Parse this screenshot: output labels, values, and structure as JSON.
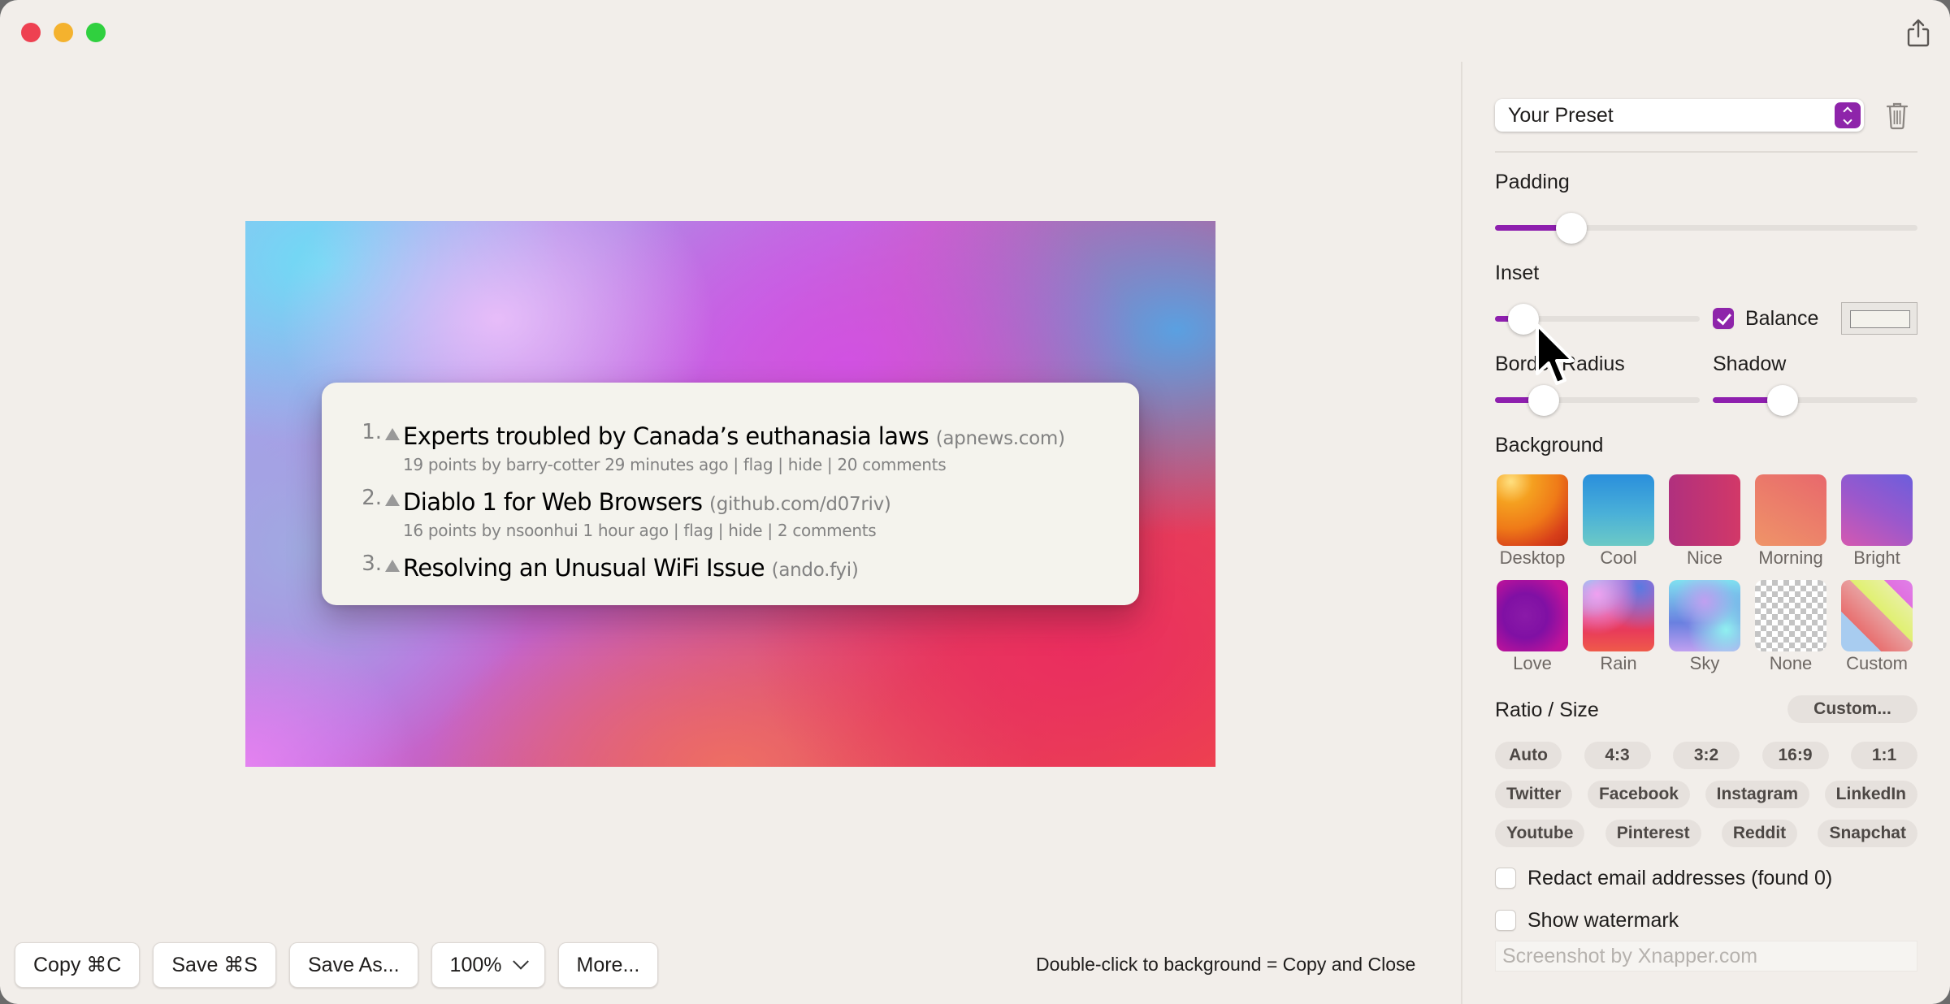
{
  "window": {
    "traffic_lights": [
      "close",
      "minimize",
      "zoom"
    ]
  },
  "canvas": {
    "background_preset": "Rain",
    "items": [
      {
        "rank": "1.",
        "title": "Experts troubled by Canada’s euthanasia laws",
        "site": "(apnews.com)",
        "subtext": "19 points by barry-cotter 29 minutes ago | flag | hide | 20 comments"
      },
      {
        "rank": "2.",
        "title": "Diablo 1 for Web Browsers",
        "site": "(github.com/d07riv)",
        "subtext": "16 points by nsoonhui 1 hour ago | flag | hide | 2 comments"
      },
      {
        "rank": "3.",
        "title": "Resolving an Unusual WiFi Issue",
        "site": "(ando.fyi)",
        "subtext": ""
      }
    ]
  },
  "toolbar": {
    "copy_label": "Copy ⌘C",
    "save_label": "Save ⌘S",
    "save_as_label": "Save As...",
    "zoom_value": "100%",
    "more_label": "More...",
    "hint": "Double-click to background = Copy and Close"
  },
  "sidebar": {
    "preset": {
      "selected": "Your Preset"
    },
    "padding": {
      "label": "Padding",
      "value_fraction": 0.18
    },
    "inset": {
      "label": "Inset",
      "value_fraction": 0.14
    },
    "balance": {
      "label": "Balance",
      "checked": true
    },
    "border_radius": {
      "label": "Border Radius",
      "value_fraction": 0.24
    },
    "shadow": {
      "label": "Shadow",
      "value_fraction": 0.34
    },
    "background": {
      "label": "Background",
      "options": [
        "Desktop",
        "Cool",
        "Nice",
        "Morning",
        "Bright",
        "Love",
        "Rain",
        "Sky",
        "None",
        "Custom"
      ]
    },
    "ratio": {
      "label": "Ratio / Size",
      "custom_label": "Custom...",
      "row1": [
        "Auto",
        "4:3",
        "3:2",
        "16:9",
        "1:1"
      ],
      "row2": [
        "Twitter",
        "Facebook",
        "Instagram",
        "LinkedIn"
      ],
      "row3": [
        "Youtube",
        "Pinterest",
        "Reddit",
        "Snapchat"
      ]
    },
    "redact": {
      "label": "Redact email addresses (found 0)",
      "checked": false
    },
    "watermark": {
      "label": "Show watermark",
      "checked": false,
      "placeholder": "Screenshot by Xnapper.com"
    }
  },
  "colors": {
    "accent": "#8e24aa",
    "window_bg": "#f2eeea",
    "close": "#ee4151",
    "minimize": "#f4b22e",
    "zoom": "#30d03f"
  }
}
